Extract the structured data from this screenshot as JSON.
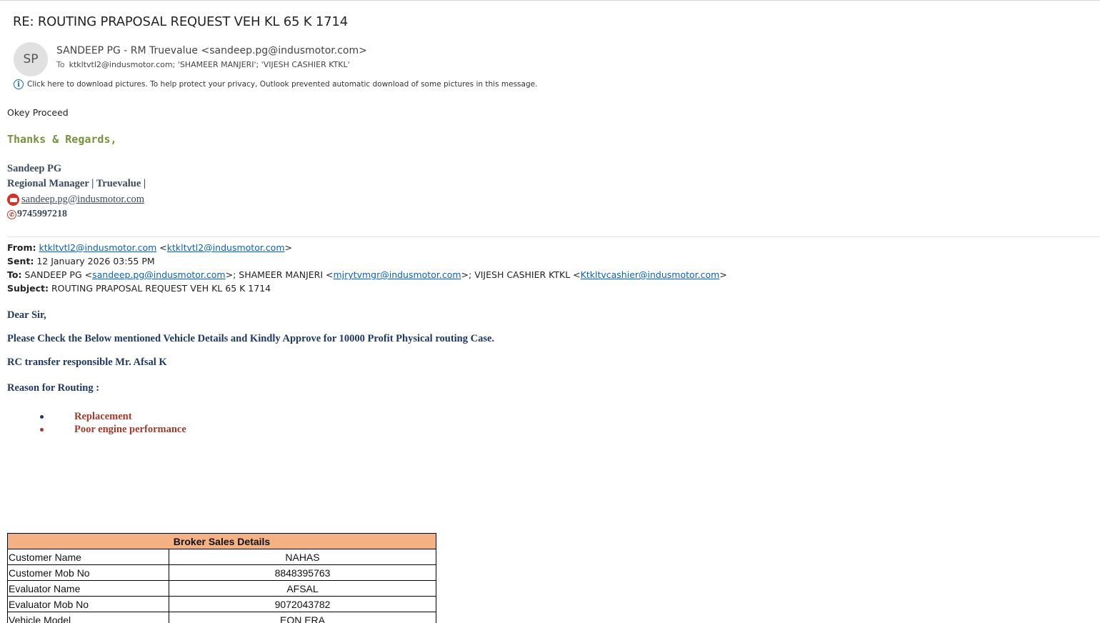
{
  "email": {
    "subject": "RE: ROUTING PRAPOSAL REQUEST  VEH KL 65 K 1714",
    "avatar_initials": "SP",
    "sender": "SANDEEP PG - RM Truevalue <sandeep.pg@indusmotor.com>",
    "to_label": "To",
    "recipients": "ktkltvtl2@indusmotor.com; 'SHAMEER MANJERI'; 'VIJESH CASHIER KTKL'",
    "info_message": "Click here to download pictures. To help protect your privacy, Outlook prevented automatic download of some pictures in this message."
  },
  "reply": {
    "text": "Okey Proceed",
    "thanks": "Thanks & Regards,",
    "sig_name": "Sandeep PG",
    "sig_title": "Regional Manager | Truevalue |",
    "sig_email": "sandeep.pg@indusmotor.com",
    "sig_phone": "9745997218"
  },
  "original": {
    "from_label": "From:",
    "from_link": "ktkltvtl2@indusmotor.com",
    "from_bracket_open": " <",
    "from_link2": "ktkltvtl2@indusmotor.com",
    "from_bracket_close": ">",
    "sent_label": "Sent:",
    "sent_value": " 12 January 2026 03:55 PM",
    "to_label": "To:",
    "to_name1": " SANDEEP PG <",
    "to_link1": "sandeep.pg@indusmotor.com",
    "to_name2": ">; SHAMEER MANJERI <",
    "to_link2": "mjrytvmgr@indusmotor.com",
    "to_name3": ">; VIJESH CASHIER KTKL <",
    "to_link3": "Ktkltvcashier@indusmotor.com",
    "to_end": ">",
    "subject_label": "Subject:",
    "subject_value": " ROUTING PRAPOSAL REQUEST VEH KL 65 K 1714",
    "greeting": "Dear Sir,",
    "line1": "Please Check the Below mentioned Vehicle Details and Kindly Approve for 10000 Profit Physical routing Case.",
    "line2": "RC transfer responsible Mr. Afsal K",
    "line3": "Reason for Routing :",
    "reasons": [
      "Replacement",
      "Poor engine performance"
    ]
  },
  "table": {
    "header": "Broker Sales Details",
    "rows": [
      {
        "key": "Customer Name",
        "value": "NAHAS"
      },
      {
        "key": "Customer Mob No",
        "value": "8848395763"
      },
      {
        "key": "Evaluator Name",
        "value": "AFSAL"
      },
      {
        "key": "Evaluator Mob No",
        "value": "9072043782"
      },
      {
        "key": "Vehicle Model",
        "value": "EON ERA"
      }
    ]
  },
  "colors": {
    "thanks_green": "#76923c",
    "body_navy": "#1f3864",
    "reason_red": "#a33b2c",
    "table_header": "#f4b183",
    "link_blue": "#0563c1"
  }
}
